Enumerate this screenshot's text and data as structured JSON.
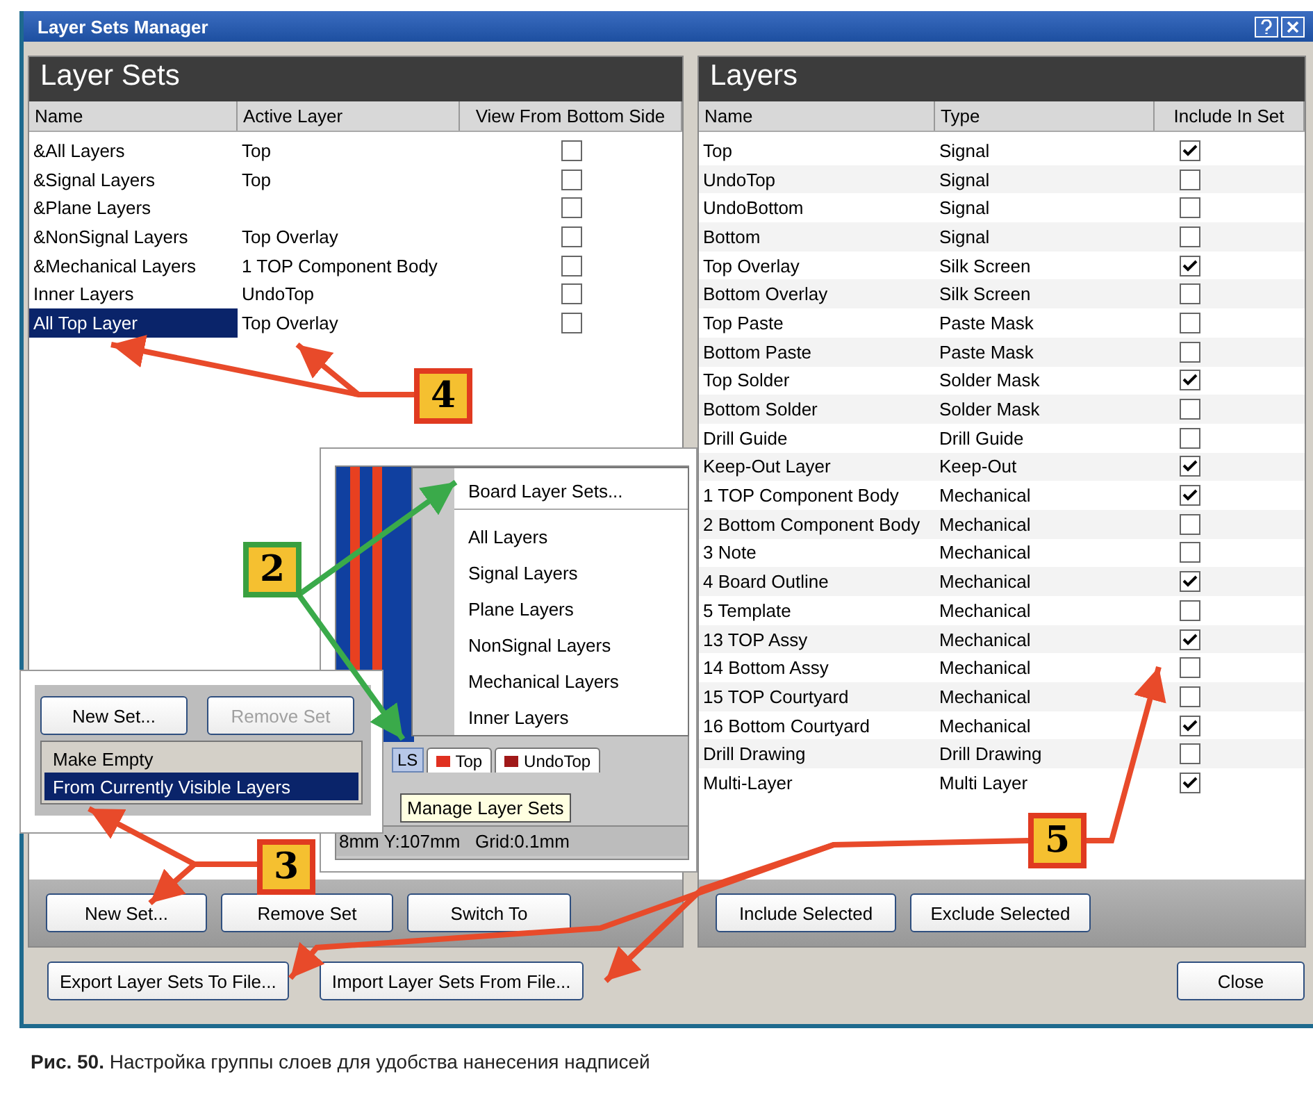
{
  "window": {
    "title": "Layer Sets Manager"
  },
  "layer_sets": {
    "title": "Layer Sets",
    "columns": [
      "Name",
      "Active Layer",
      "View From Bottom Side"
    ],
    "rows": [
      {
        "name": "&All Layers",
        "active_layer": "Top",
        "view_from_bottom": false,
        "selected": false
      },
      {
        "name": "&Signal Layers",
        "active_layer": "Top",
        "view_from_bottom": false,
        "selected": false
      },
      {
        "name": "&Plane Layers",
        "view_from_bottom": false,
        "selected": false
      },
      {
        "name": "&NonSignal Layers",
        "active_layer": "Top Overlay",
        "view_from_bottom": false,
        "selected": false
      },
      {
        "name": "&Mechanical Layers",
        "active_layer": "1 TOP Component Body",
        "view_from_bottom": false,
        "selected": false
      },
      {
        "name": "Inner Layers",
        "active_layer": "UndoTop",
        "view_from_bottom": false,
        "selected": false
      },
      {
        "name": "All Top Layer",
        "active_layer": "Top Overlay",
        "view_from_bottom": false,
        "selected": true
      }
    ],
    "buttons": [
      "New Set...",
      "Remove Set",
      "Switch To"
    ]
  },
  "layers": {
    "title": "Layers",
    "columns": [
      "Name",
      "Type",
      "Include In Set"
    ],
    "rows": [
      {
        "name": "Top",
        "type": "Signal",
        "included": true
      },
      {
        "name": "UndoTop",
        "type": "Signal",
        "included": false
      },
      {
        "name": "UndoBottom",
        "type": "Signal",
        "included": false
      },
      {
        "name": "Bottom",
        "type": "Signal",
        "included": false
      },
      {
        "name": "Top Overlay",
        "type": "Silk Screen",
        "included": true
      },
      {
        "name": "Bottom Overlay",
        "type": "Silk Screen",
        "included": false
      },
      {
        "name": "Top Paste",
        "type": "Paste Mask",
        "included": false
      },
      {
        "name": "Bottom Paste",
        "type": "Paste Mask",
        "included": false
      },
      {
        "name": "Top Solder",
        "type": "Solder Mask",
        "included": true
      },
      {
        "name": "Bottom Solder",
        "type": "Solder Mask",
        "included": false
      },
      {
        "name": "Drill Guide",
        "type": "Drill Guide",
        "included": false
      },
      {
        "name": "Keep-Out Layer",
        "type": "Keep-Out",
        "included": true
      },
      {
        "name": "1 TOP Component Body",
        "type": "Mechanical",
        "included": true
      },
      {
        "name": "2 Bottom Component Body",
        "type": "Mechanical",
        "included": false
      },
      {
        "name": "3 Note",
        "type": "Mechanical",
        "included": false
      },
      {
        "name": "4 Board Outline",
        "type": "Mechanical",
        "included": true
      },
      {
        "name": "5 Template",
        "type": "Mechanical",
        "included": false
      },
      {
        "name": "13 TOP Assy",
        "type": "Mechanical",
        "included": true
      },
      {
        "name": "14 Bottom Assy",
        "type": "Mechanical",
        "included": false
      },
      {
        "name": "15 TOP Courtyard",
        "type": "Mechanical",
        "included": false
      },
      {
        "name": "16 Bottom Courtyard",
        "type": "Mechanical",
        "included": true
      },
      {
        "name": "Drill Drawing",
        "type": "Drill Drawing",
        "included": false
      },
      {
        "name": "Multi-Layer",
        "type": "Multi Layer",
        "included": true
      }
    ],
    "buttons": [
      "Include Selected",
      "Exclude Selected"
    ]
  },
  "footer_buttons": [
    "Export Layer Sets To File...",
    "Import Layer Sets From File..."
  ],
  "close_button": "Close",
  "menu_inset": {
    "menu": [
      {
        "label": "Board Layer Sets...",
        "kind": "header"
      },
      {
        "label": "All Layers",
        "kind": "item"
      },
      {
        "label": "Signal Layers",
        "kind": "item"
      },
      {
        "label": "Plane Layers",
        "kind": "item"
      },
      {
        "label": "NonSignal Layers",
        "kind": "item"
      },
      {
        "label": "Mechanical Layers",
        "kind": "item"
      },
      {
        "label": "Inner Layers",
        "kind": "item"
      }
    ],
    "layer_button": "LS",
    "tabs": [
      {
        "label": "Top",
        "color": "#e03020"
      },
      {
        "label": "UndoTop",
        "color": "#a01818"
      }
    ],
    "tooltip": "Manage Layer Sets",
    "status": "8mm Y:107mm   Grid:0.1mm"
  },
  "new_set_inset": {
    "buttons": [
      {
        "label": "New Set...",
        "disabled": false
      },
      {
        "label": "Remove Set",
        "disabled": true
      }
    ],
    "menu": [
      {
        "label": "Make Empty",
        "selected": false
      },
      {
        "label": "From Currently Visible Layers",
        "selected": true
      }
    ]
  },
  "callouts": [
    {
      "label": "4",
      "color": "#e03a20"
    },
    {
      "label": "2",
      "color": "#3aa040"
    },
    {
      "label": "3",
      "color": "#e03a20"
    },
    {
      "label": "5",
      "color": "#e03a20"
    }
  ],
  "caption": "**Рис. 50.** Настройка группы слоев для удобства нанесения надписей"
}
